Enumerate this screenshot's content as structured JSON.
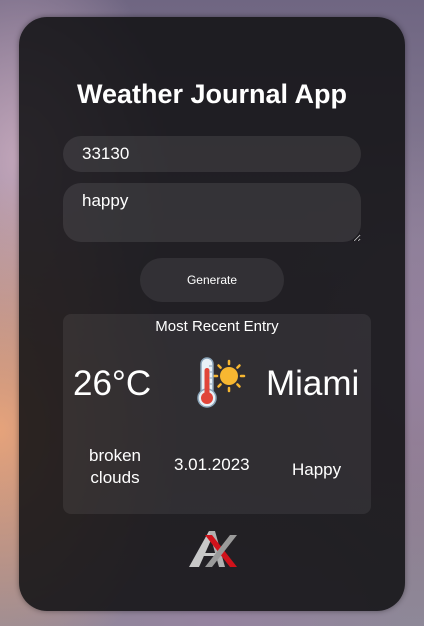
{
  "app": {
    "title": "Weather Journal App"
  },
  "form": {
    "zip_value": "33130",
    "feelings_value": "happy",
    "generate_label": "Generate"
  },
  "entry": {
    "heading": "Most Recent Entry",
    "temperature": "26°C",
    "weather_icon": "thermometer-sun-icon",
    "city": "Miami",
    "description": "broken clouds",
    "date": "3.01.2023",
    "feeling": "Happy"
  },
  "logo": {
    "letters": "AX"
  },
  "colors": {
    "card_background": "#121214",
    "text": "#ffffff",
    "logo_red": "#d0121b",
    "logo_silver": "#c8c8c8"
  }
}
